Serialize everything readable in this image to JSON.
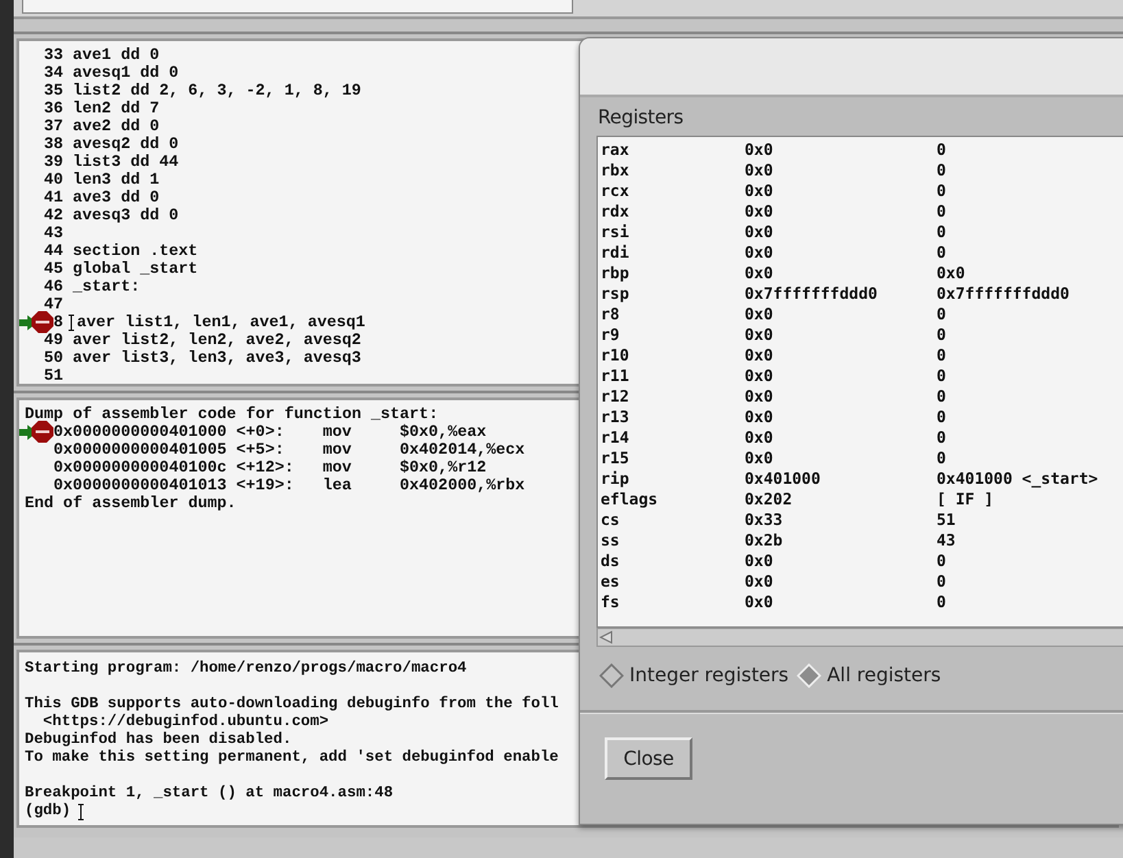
{
  "source": {
    "lines": [
      {
        "number": "33",
        "code": "ave1 dd 0",
        "breakpoint": false,
        "current": false
      },
      {
        "number": "34",
        "code": "avesq1 dd 0",
        "breakpoint": false,
        "current": false
      },
      {
        "number": "35",
        "code": "list2 dd 2, 6, 3, -2, 1, 8, 19",
        "breakpoint": false,
        "current": false
      },
      {
        "number": "36",
        "code": "len2 dd 7",
        "breakpoint": false,
        "current": false
      },
      {
        "number": "37",
        "code": "ave2 dd 0",
        "breakpoint": false,
        "current": false
      },
      {
        "number": "38",
        "code": "avesq2 dd 0",
        "breakpoint": false,
        "current": false
      },
      {
        "number": "39",
        "code": "list3 dd 44",
        "breakpoint": false,
        "current": false
      },
      {
        "number": "40",
        "code": "len3 dd 1",
        "breakpoint": false,
        "current": false
      },
      {
        "number": "41",
        "code": "ave3 dd 0",
        "breakpoint": false,
        "current": false
      },
      {
        "number": "42",
        "code": "avesq3 dd 0",
        "breakpoint": false,
        "current": false
      },
      {
        "number": "43",
        "breakpoint": false,
        "current": false
      },
      {
        "number": "44",
        "code": "section .text",
        "breakpoint": false,
        "current": false
      },
      {
        "number": "45",
        "code": "global _start",
        "breakpoint": false,
        "current": false
      },
      {
        "number": "46",
        "code": "_start:",
        "breakpoint": false,
        "current": false
      },
      {
        "number": "47",
        "breakpoint": false,
        "current": false
      },
      {
        "number": "8",
        "code": "aver list1, len1, ave1, avesq1",
        "breakpoint": true,
        "current": true
      },
      {
        "number": "49",
        "code": "aver list2, len2, ave2, avesq2",
        "breakpoint": false,
        "current": false
      },
      {
        "number": "50",
        "code": "aver list3, len3, ave3, avesq3",
        "breakpoint": false,
        "current": false
      },
      {
        "number": "51",
        "breakpoint": false,
        "current": false
      }
    ]
  },
  "assembly": {
    "header": "Dump of assembler code for function _start:",
    "lines": [
      {
        "address": "0x0000000000401000",
        "offset": "<+0>:",
        "op": "mov",
        "args": "$0x0,%eax",
        "breakpoint": true,
        "current": true
      },
      {
        "address": "0x0000000000401005",
        "offset": "<+5>:",
        "op": "mov",
        "args": "0x402014,%ecx",
        "breakpoint": false,
        "current": false
      },
      {
        "address": "0x000000000040100c",
        "offset": "<+12>:",
        "op": "mov",
        "args": "$0x0,%r12",
        "breakpoint": false,
        "current": false
      },
      {
        "address": "0x0000000000401013",
        "offset": "<+19>:",
        "op": "lea",
        "args": "0x402000,%rbx",
        "breakpoint": false,
        "current": false
      }
    ],
    "footer": "End of assembler dump."
  },
  "console": {
    "blocks": [
      [
        "Starting program: /home/renzo/progs/macro/macro4"
      ],
      [
        "This GDB supports auto-downloading debuginfo from the foll",
        "  <https://debuginfod.ubuntu.com>",
        "Debuginfod has been disabled.",
        "To make this setting permanent, add 'set debuginfod enable"
      ],
      [
        "Breakpoint 1, _start () at macro4.asm:48",
        "(gdb)"
      ]
    ]
  },
  "registers_dialog": {
    "title": "Registers",
    "rows": [
      {
        "name": "rax",
        "hex": "0x0",
        "natural": "0"
      },
      {
        "name": "rbx",
        "hex": "0x0",
        "natural": "0"
      },
      {
        "name": "rcx",
        "hex": "0x0",
        "natural": "0"
      },
      {
        "name": "rdx",
        "hex": "0x0",
        "natural": "0"
      },
      {
        "name": "rsi",
        "hex": "0x0",
        "natural": "0"
      },
      {
        "name": "rdi",
        "hex": "0x0",
        "natural": "0"
      },
      {
        "name": "rbp",
        "hex": "0x0",
        "natural": "0x0"
      },
      {
        "name": "rsp",
        "hex": "0x7fffffffddd0",
        "natural": "0x7fffffffddd0"
      },
      {
        "name": "r8",
        "hex": "0x0",
        "natural": "0"
      },
      {
        "name": "r9",
        "hex": "0x0",
        "natural": "0"
      },
      {
        "name": "r10",
        "hex": "0x0",
        "natural": "0"
      },
      {
        "name": "r11",
        "hex": "0x0",
        "natural": "0"
      },
      {
        "name": "r12",
        "hex": "0x0",
        "natural": "0"
      },
      {
        "name": "r13",
        "hex": "0x0",
        "natural": "0"
      },
      {
        "name": "r14",
        "hex": "0x0",
        "natural": "0"
      },
      {
        "name": "r15",
        "hex": "0x0",
        "natural": "0"
      },
      {
        "name": "rip",
        "hex": "0x401000",
        "natural": "0x401000 <_start>"
      },
      {
        "name": "eflags",
        "hex": "0x202",
        "natural": "[ IF ]"
      },
      {
        "name": "cs",
        "hex": "0x33",
        "natural": "51"
      },
      {
        "name": "ss",
        "hex": "0x2b",
        "natural": "43"
      },
      {
        "name": "ds",
        "hex": "0x0",
        "natural": "0"
      },
      {
        "name": "es",
        "hex": "0x0",
        "natural": "0"
      },
      {
        "name": "fs",
        "hex": "0x0",
        "natural": "0"
      }
    ],
    "options": [
      {
        "label": "Integer registers",
        "selected": false
      },
      {
        "label": "All registers",
        "selected": true
      }
    ],
    "buttons": [
      "Close"
    ]
  }
}
